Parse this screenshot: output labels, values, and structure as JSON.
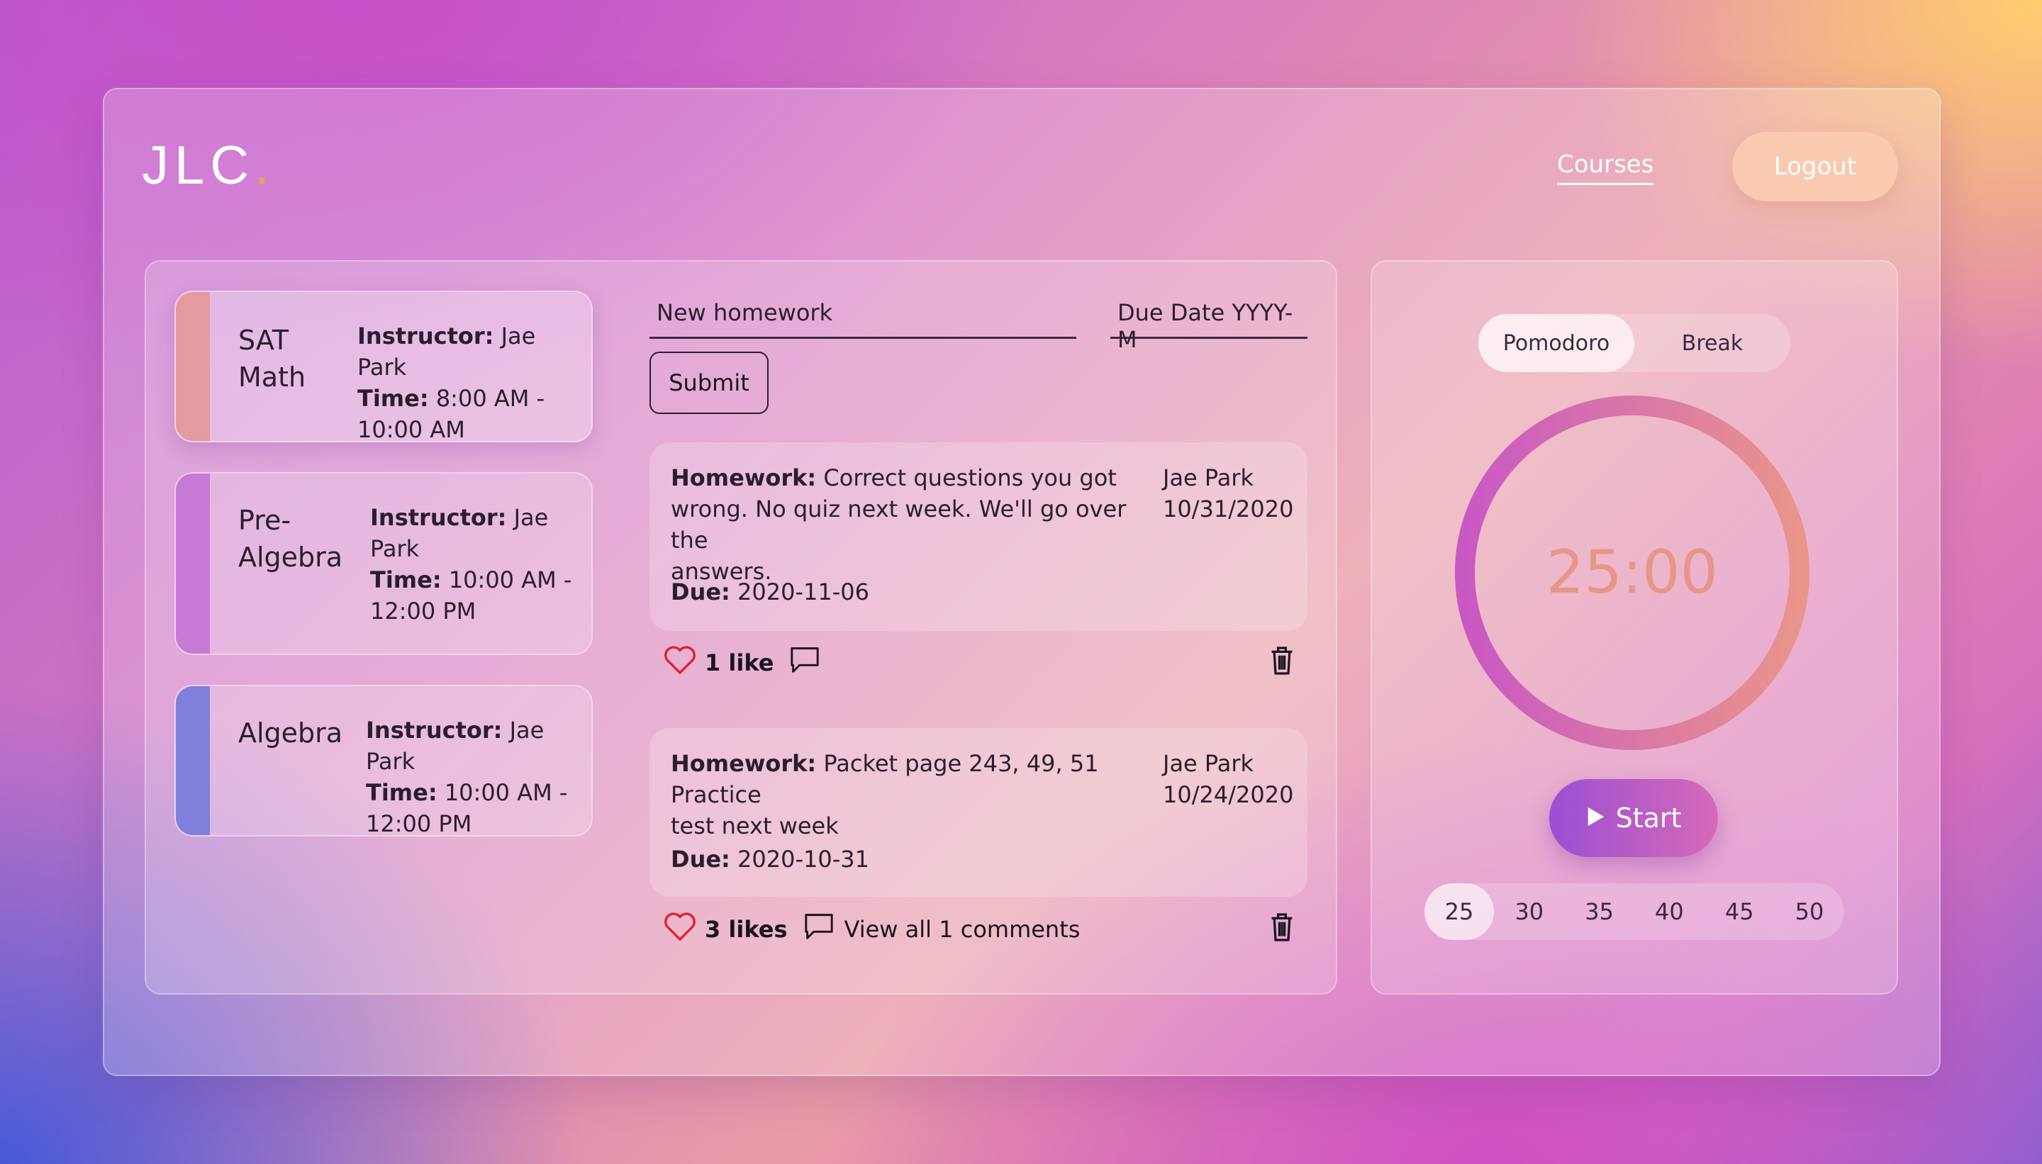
{
  "app": {
    "logo_text": "JLC",
    "logo_dot": ".",
    "nav_courses": "Courses",
    "logout_label": "Logout"
  },
  "courses": [
    {
      "name_line1": "SAT",
      "name_line2": "Math",
      "instructor_label": "Instructor:",
      "instructor": "Jae Park",
      "time_label": "Time:",
      "time_line1": "8:00 AM -",
      "time_line2": "10:00 AM",
      "stripe_color": "#e39aa0",
      "active": true
    },
    {
      "name_line1": "Pre-",
      "name_line2": "Algebra",
      "instructor_label": "Instructor:",
      "instructor_line1": "Jae",
      "instructor_line2": "Park",
      "time_label": "Time:",
      "time_line1": "10:00 AM -",
      "time_line2": "12:00 PM",
      "stripe_color": "#c77ad4",
      "active": false
    },
    {
      "name_line1": "Algebra",
      "instructor_label": "Instructor:",
      "instructor": "Jae Park",
      "time_label": "Time:",
      "time_line1": "10:00 AM -",
      "time_line2": "12:00 PM",
      "stripe_color": "#8080dc",
      "active": false
    }
  ],
  "homework_form": {
    "new_homework_placeholder": "New homework",
    "due_date_placeholder": "Due Date YYYY-M",
    "submit_label": "Submit"
  },
  "homework": [
    {
      "label": "Homework:",
      "text_line1": "Correct questions you got",
      "text_line2": "wrong. No quiz next week. We'll go over the",
      "text_line3": "answers.",
      "author": "Jae Park",
      "posted": "10/31/2020",
      "due_label": "Due:",
      "due": "2020-11-06",
      "likes": "1 like",
      "comments": ""
    },
    {
      "label": "Homework:",
      "text_line1": "Packet page 243, 49, 51 Practice",
      "text_line2": "test next week",
      "text_line3": "",
      "author": "Jae Park",
      "posted": "10/24/2020",
      "due_label": "Due:",
      "due": "2020-10-31",
      "likes": "3 likes",
      "comments": "View all 1 comments"
    }
  ],
  "timer": {
    "mode_pomodoro": "Pomodoro",
    "mode_break": "Break",
    "active_mode": "Pomodoro",
    "time": "25:00",
    "start_label": "Start",
    "durations": [
      "25",
      "30",
      "35",
      "40",
      "45",
      "50"
    ],
    "selected_duration": "25",
    "ring_colors": [
      "#c958c4",
      "#e9958a"
    ]
  },
  "icons": {
    "like": "heart-icon",
    "comment": "comment-icon",
    "delete": "trash-icon",
    "play": "play-icon"
  }
}
